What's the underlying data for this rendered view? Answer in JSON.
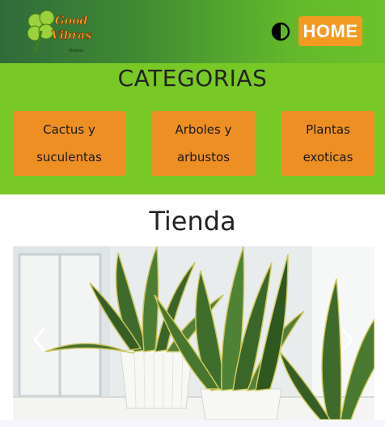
{
  "header": {
    "logo": {
      "line1": "Good",
      "line2": "Vibras",
      "tagline": "Viveros"
    },
    "theme_toggle_icon": "half-circle-contrast-icon",
    "home_label": "HOME"
  },
  "categories": {
    "title": "CATEGORIAS",
    "items": [
      {
        "line1": "Cactus y",
        "line2": "suculentas"
      },
      {
        "line1": "Arboles y",
        "line2": "arbustos"
      },
      {
        "line1": "Plantas",
        "line2": "exoticas"
      }
    ]
  },
  "shop": {
    "title": "Tienda",
    "carousel": {
      "prev_icon": "chevron-left-icon",
      "next_icon": "chevron-right-icon",
      "slide_subject": "snake plants in white pots"
    }
  },
  "colors": {
    "header_dark": "#2f6b3a",
    "header_light": "#6cc22b",
    "category_bg": "#79c926",
    "accent_orange": "#f39a22"
  }
}
